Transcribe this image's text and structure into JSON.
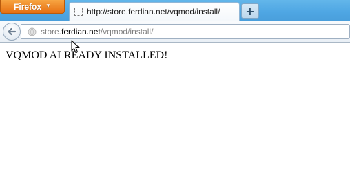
{
  "browser": {
    "menu_button_label": "Firefox",
    "tab": {
      "title": "http://store.ferdian.net/vqmod/install/",
      "icon": "blank-page-icon"
    },
    "new_tab_label": "+",
    "address": {
      "prefix": "store.",
      "host": "ferdian.net",
      "path": "/vqmod/install/"
    },
    "colors": {
      "tabstrip": "#4ea6e3",
      "menu_button": "#e66f12"
    }
  },
  "page": {
    "message": "VQMOD ALREADY INSTALLED!"
  }
}
